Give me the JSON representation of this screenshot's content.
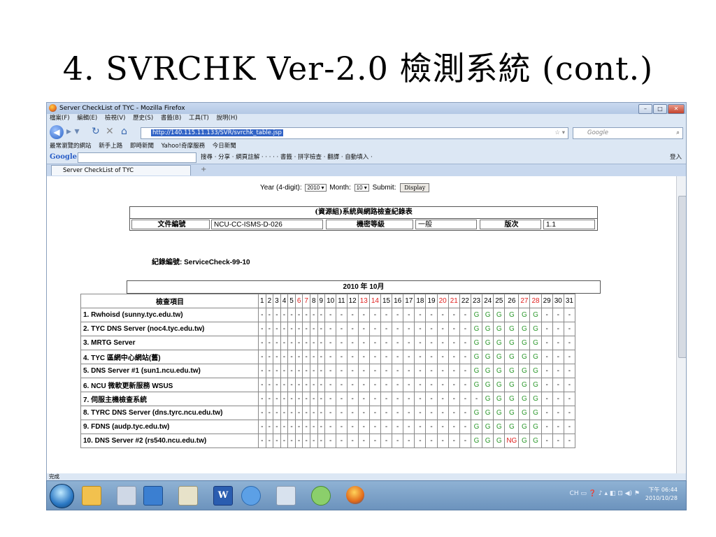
{
  "slide": {
    "title": "4. SVRCHK Ver-2.0 檢測系統 (cont.)"
  },
  "browser": {
    "window_title": "Server CheckList of TYC - Mozilla Firefox",
    "menu": [
      "檔案(F)",
      "編輯(E)",
      "檢視(V)",
      "歷史(S)",
      "書籤(B)",
      "工具(T)",
      "說明(H)"
    ],
    "url": "http://140.115.11.133/SVR/svrchk_table.jsp",
    "search_placeholder": "Google",
    "bookmarks": [
      "最常瀏覽的網站",
      "新手上路",
      "即時新聞",
      "Yahoo!奇摩服務",
      "今日新聞"
    ],
    "google_toolbar": {
      "logo": "Google",
      "items": "搜尋 · 分享 · 網頁註解 · · · · · 書籤 · 拼字檢查 · 翻譯 · 自動填入 ·",
      "signin": "登入"
    },
    "tab_label": "Server CheckList of TYC",
    "status": "完成"
  },
  "form": {
    "year_label": "Year (4-digit):",
    "year_value": "2010",
    "month_label": "Month:",
    "month_value": "10",
    "submit_label": "Submit:",
    "display_button": "Display"
  },
  "record": {
    "header": "(資源組)系統與網路檢查紀錄表",
    "doc_no_label": "文件編號",
    "doc_no_value": "NCU-CC-ISMS-D-026",
    "security_label": "機密等級",
    "security_value": "一般",
    "version_label": "版次",
    "version_value": "1.1",
    "record_no": "紀錄編號: ServiceCheck-99-10"
  },
  "month_header": "2010 年 10月",
  "table": {
    "item_header": "檢查項目",
    "days": [
      1,
      2,
      3,
      4,
      5,
      6,
      7,
      8,
      9,
      10,
      11,
      12,
      13,
      14,
      15,
      16,
      17,
      18,
      19,
      20,
      21,
      22,
      23,
      24,
      25,
      26,
      27,
      28,
      29,
      30,
      31
    ],
    "weekend_days": [
      6,
      7,
      13,
      14,
      20,
      21,
      27,
      28
    ],
    "rows": [
      {
        "name": "1. Rwhoisd (sunny.tyc.edu.tw)",
        "start": 23,
        "marks": [
          "G",
          "G",
          "G",
          "G",
          "G",
          "G"
        ]
      },
      {
        "name": "2. TYC DNS Server (noc4.tyc.edu.tw)",
        "start": 23,
        "marks": [
          "G",
          "G",
          "G",
          "G",
          "G",
          "G"
        ]
      },
      {
        "name": "3. MRTG Server",
        "start": 23,
        "marks": [
          "G",
          "G",
          "G",
          "G",
          "G",
          "G"
        ]
      },
      {
        "name": "4. TYC 區網中心網站(舊)",
        "start": 23,
        "marks": [
          "G",
          "G",
          "G",
          "G",
          "G",
          "G"
        ]
      },
      {
        "name": "5. DNS Server #1 (sun1.ncu.edu.tw)",
        "start": 23,
        "marks": [
          "G",
          "G",
          "G",
          "G",
          "G",
          "G"
        ]
      },
      {
        "name": "6. NCU 微軟更新服務 WSUS",
        "start": 23,
        "marks": [
          "G",
          "G",
          "G",
          "G",
          "G",
          "G"
        ]
      },
      {
        "name": "7. 伺服主機檢查系統",
        "start": 24,
        "marks": [
          "G",
          "G",
          "G",
          "G",
          "G"
        ]
      },
      {
        "name": "8. TYRC DNS Server (dns.tyrc.ncu.edu.tw)",
        "start": 23,
        "marks": [
          "G",
          "G",
          "G",
          "G",
          "G",
          "G"
        ]
      },
      {
        "name": "9. FDNS (audp.tyc.edu.tw)",
        "start": 23,
        "marks": [
          "G",
          "G",
          "G",
          "G",
          "G",
          "G"
        ]
      },
      {
        "name": "10. DNS Server #2 (rs540.ncu.edu.tw)",
        "start": 23,
        "marks": [
          "G",
          "G",
          "G",
          "NG",
          "G",
          "G"
        ]
      }
    ]
  },
  "taskbar": {
    "tray_text": "CH",
    "time": "下午 06:44",
    "date": "2010/10/28"
  },
  "colors": {
    "good": "#2e9a2e",
    "bad": "#e0201e",
    "weekend": "#e0201e"
  }
}
